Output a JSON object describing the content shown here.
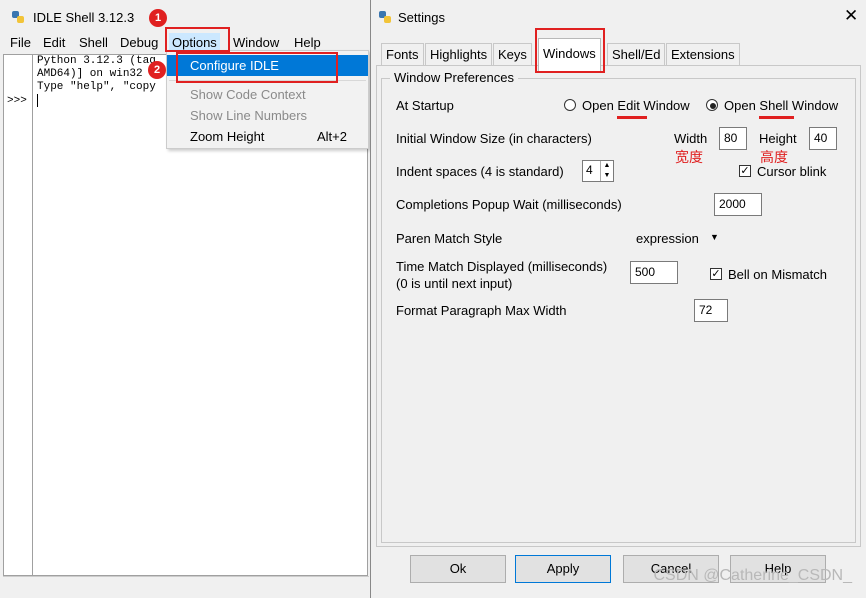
{
  "shell": {
    "title": "IDLE Shell 3.12.3",
    "menu": [
      "File",
      "Edit",
      "Shell",
      "Debug",
      "Options",
      "Window",
      "Help"
    ],
    "lines": [
      "Python 3.12.3 (tag",
      "AMD64)] on win32",
      "Type \"help\", \"copy"
    ],
    "prompt": ">>>"
  },
  "dropdown": {
    "items": [
      "Configure IDLE",
      "Show Code Context",
      "Show Line Numbers",
      "Zoom Height"
    ],
    "zoom_shortcut": "Alt+2"
  },
  "annotations": {
    "badge1": "1",
    "badge2": "2",
    "width_note": "宽度",
    "height_note": "高度"
  },
  "settings": {
    "title": "Settings",
    "tabs": [
      "Fonts",
      "Highlights",
      "Keys",
      "Windows",
      "Shell/Ed",
      "Extensions"
    ],
    "active_tab": "Windows",
    "group_title": "Window Preferences",
    "at_startup": {
      "label": "At Startup",
      "opt_edit": "Open Edit Window",
      "opt_shell": "Open Shell Window",
      "selected": "Open Shell Window"
    },
    "window_size": {
      "label": "Initial Window Size  (in characters)",
      "width_label": "Width",
      "width": "80",
      "height_label": "Height",
      "height": "40"
    },
    "indent": {
      "label": "Indent spaces (4 is standard)",
      "value": "4"
    },
    "cursor_blink": {
      "label": "Cursor blink",
      "checked": true
    },
    "completions": {
      "label": "Completions Popup Wait (milliseconds)",
      "value": "2000"
    },
    "paren": {
      "label": "Paren Match Style",
      "value": "expression"
    },
    "time_match": {
      "label1": "Time Match Displayed (milliseconds)",
      "label2": "(0 is until next input)",
      "value": "500"
    },
    "bell": {
      "label": "Bell on Mismatch",
      "checked": true
    },
    "format_width": {
      "label": "Format Paragraph Max Width",
      "value": "72"
    },
    "buttons": [
      "Ok",
      "Apply",
      "Cancel",
      "Help"
    ],
    "watermark": "CSDN @Catherine_CSDN_"
  },
  "colors": {
    "accent": "#0078d7",
    "annotation": "#e02020"
  }
}
